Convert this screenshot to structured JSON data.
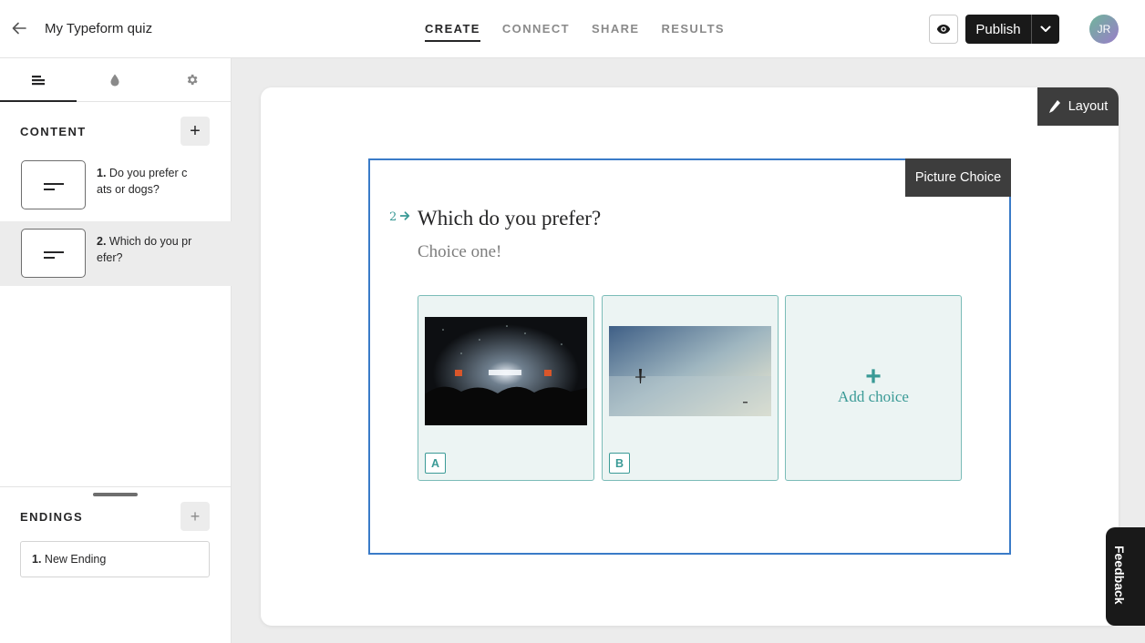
{
  "header": {
    "form_title": "My Typeform quiz",
    "tabs": [
      "CREATE",
      "CONNECT",
      "SHARE",
      "RESULTS"
    ],
    "active_tab": "CREATE",
    "publish_label": "Publish",
    "avatar_initials": "JR"
  },
  "sidebar": {
    "content_heading": "CONTENT",
    "add_symbol": "+",
    "questions": [
      {
        "number": "1.",
        "text": "Do you prefer cats or dogs?"
      },
      {
        "number": "2.",
        "text": "Which do you prefer?"
      }
    ],
    "selected_question": 2,
    "endings_heading": "ENDINGS",
    "endings": [
      {
        "number": "1.",
        "text": "New Ending"
      }
    ]
  },
  "canvas": {
    "layout_label": "Layout",
    "block_type": "Picture Choice",
    "question_index": "2",
    "question_title": "Which do you prefer?",
    "question_description": "Choice one!",
    "choices": [
      {
        "key": "A",
        "image": "concert-crowd-photo"
      },
      {
        "key": "B",
        "image": "calm-sea-photo"
      }
    ],
    "add_choice_symbol": "+",
    "add_choice_label": "Add choice"
  },
  "feedback_label": "Feedback",
  "colors": {
    "accent": "#3a9a96",
    "selection_border": "#3a7bc8",
    "dark": "#191919"
  }
}
